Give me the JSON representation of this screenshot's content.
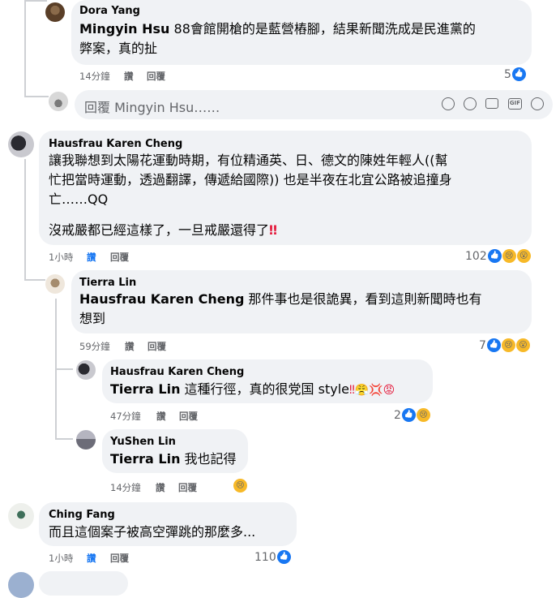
{
  "comments": {
    "c1": {
      "author": "Dora Yang",
      "mention": "Mingyin Hsu",
      "text_line1": " 88會館開槍的是藍營樁腳，結果新聞洗成是民進黨的",
      "text_line2": "弊案，真的扯",
      "time": "14分鐘",
      "like_label": "讚",
      "reply_label": "回覆",
      "reaction_count": "5"
    },
    "reply_box": {
      "placeholder": "回覆 Mingyin Hsu……"
    },
    "c2": {
      "author": "Hausfrau Karen Cheng",
      "text_line1": "讓我聯想到太陽花運動時期，有位精通英、日、德文的陳姓年輕人((幫",
      "text_line2": "忙把當時運動，透過翻譯，傳遞給國際)) 也是半夜在北宜公路被追撞身",
      "text_line3": "亡……QQ",
      "text_line4": "沒戒嚴都已經這樣了，一旦戒嚴還得了",
      "emphasis": "‼",
      "time": "1小時",
      "like_label": "讚",
      "reply_label": "回覆",
      "reaction_count": "102"
    },
    "c3": {
      "author": "Tierra Lin",
      "mention": "Hausfrau Karen Cheng",
      "text_line1": " 那件事也是很詭異，看到這則新聞時也有",
      "text_line2": "想到",
      "time": "59分鐘",
      "like_label": "讚",
      "reply_label": "回覆",
      "reaction_count": "7"
    },
    "c4": {
      "author": "Hausfrau Karen Cheng",
      "mention": "Tierra Lin",
      "text": " 這種行徑，真的很党国 style",
      "emoji": "‼😤💢😡",
      "time": "47分鐘",
      "like_label": "讚",
      "reply_label": "回覆",
      "reaction_count": "2"
    },
    "c5": {
      "author": "YuShen Lin",
      "mention": "Tierra Lin",
      "text": " 我也記得",
      "time": "14分鐘",
      "like_label": "讚",
      "reply_label": "回覆"
    },
    "c6": {
      "author": "Ching Fang",
      "text": "而且這個案子被高空彈跳的那麼多...",
      "time": "1小時",
      "like_label": "讚",
      "reply_label": "回覆",
      "reaction_count": "110"
    }
  },
  "colors": {
    "bubble": "#f0f2f5",
    "text": "#050505",
    "meta": "#65676b",
    "like_blue": "#1877f2",
    "emoji_yellow": "#f7b928",
    "thread_line": "#ced0d4",
    "emphasis_red": "#e41e3f"
  }
}
